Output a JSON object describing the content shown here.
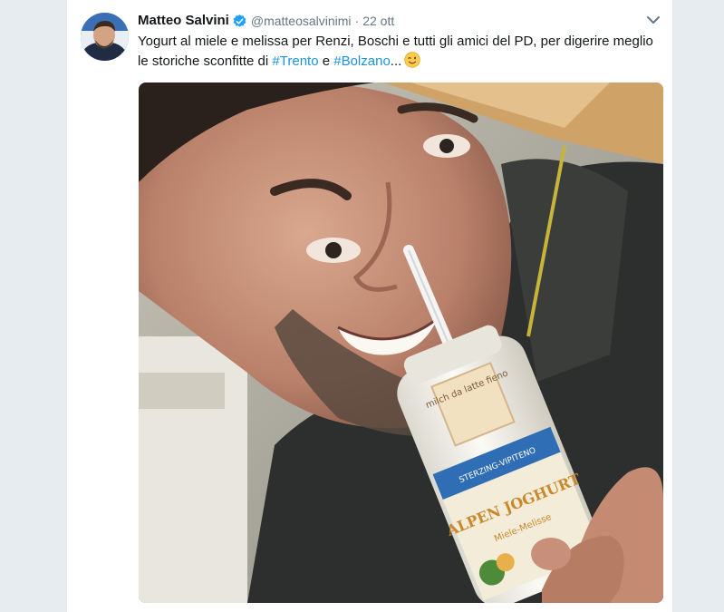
{
  "tweet": {
    "author_name": "Matteo Salvini",
    "handle": "@matteosalvinimi",
    "separator": "·",
    "timestamp": "22 ott",
    "text_part1": "Yogurt al miele e melissa per Renzi, Boschi e tutti gli amici del PD, per digerire meglio le storiche sconfitte di ",
    "hashtag1": "#Trento",
    "text_part2": " e ",
    "hashtag2": "#Bolzano",
    "text_part3": "...",
    "emoji": "winking-face",
    "verified": true,
    "icons": {
      "verified": "verified-badge-icon",
      "menu": "chevron-down-icon"
    },
    "colors": {
      "link": "#1b95e0",
      "verified": "#1da1f2",
      "text": "#14171a",
      "muted": "#657786"
    }
  },
  "media": {
    "jar_label_top": "milch da latte fieno",
    "jar_brand_small": "STERZING-VIPITENO",
    "jar_brand": "ALPEN JOGHURT",
    "jar_flavor": "Miele-Melisse"
  }
}
